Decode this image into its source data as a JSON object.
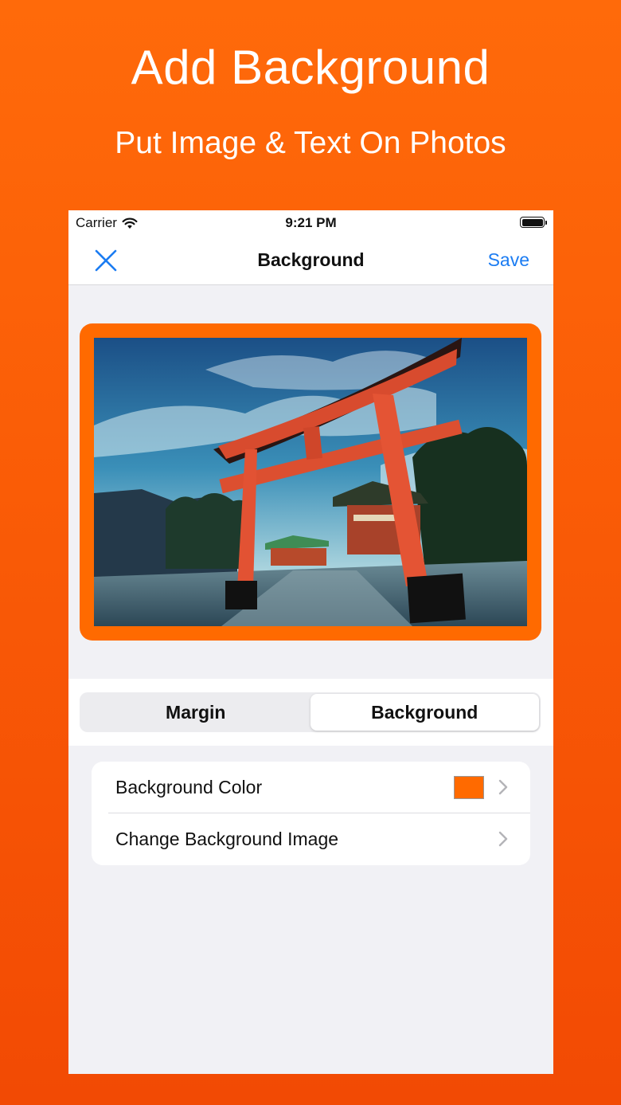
{
  "promo": {
    "headline": "Add Background",
    "subline": "Put Image & Text On Photos"
  },
  "status_bar": {
    "carrier": "Carrier",
    "time": "9:21 PM",
    "icons": [
      "wifi-icon",
      "battery-icon"
    ]
  },
  "nav": {
    "title": "Background",
    "save_label": "Save",
    "close_icon": "close-icon"
  },
  "tabs": [
    {
      "label": "Margin",
      "active": false
    },
    {
      "label": "Background",
      "active": true
    }
  ],
  "settings": {
    "rows": [
      {
        "label": "Background Color",
        "swatch_color": "#ff6a00"
      },
      {
        "label": "Change Background Image"
      }
    ]
  },
  "colors": {
    "background_gradient_top": "#ff6a0a",
    "background_gradient_bottom": "#f24a04",
    "frame": "#ff6a00",
    "accent_blue": "#1b7cf2"
  }
}
